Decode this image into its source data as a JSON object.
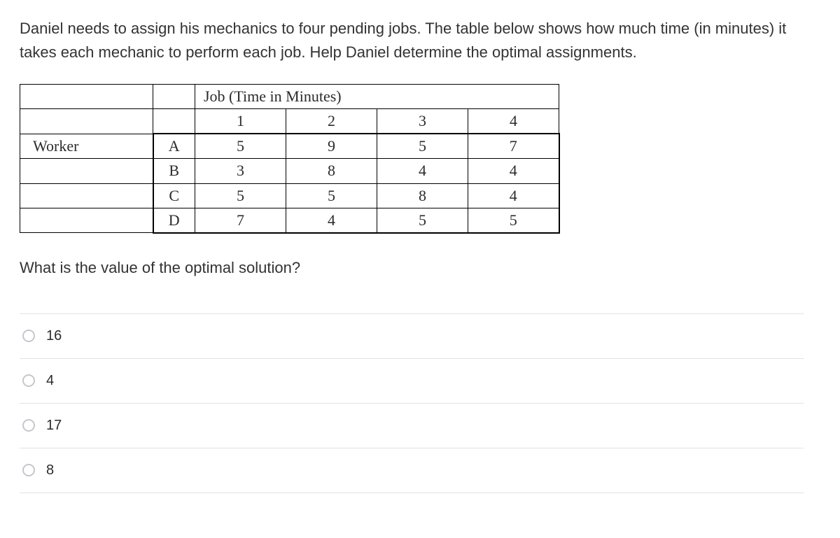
{
  "intro": "Daniel needs to assign his mechanics to four pending jobs. The table below shows how much time (in minutes) it takes each mechanic to perform each job. Help Daniel determine the optimal assignments.",
  "table": {
    "job_header": "Job (Time in Minutes)",
    "cols": [
      "1",
      "2",
      "3",
      "4"
    ],
    "row_label": "Worker",
    "workers": [
      "A",
      "B",
      "C",
      "D"
    ],
    "values": [
      [
        "5",
        "9",
        "5",
        "7"
      ],
      [
        "3",
        "8",
        "4",
        "4"
      ],
      [
        "5",
        "5",
        "8",
        "4"
      ],
      [
        "7",
        "4",
        "5",
        "5"
      ]
    ]
  },
  "question": "What is the value of the optimal solution?",
  "options": [
    "16",
    "4",
    "17",
    "8"
  ]
}
